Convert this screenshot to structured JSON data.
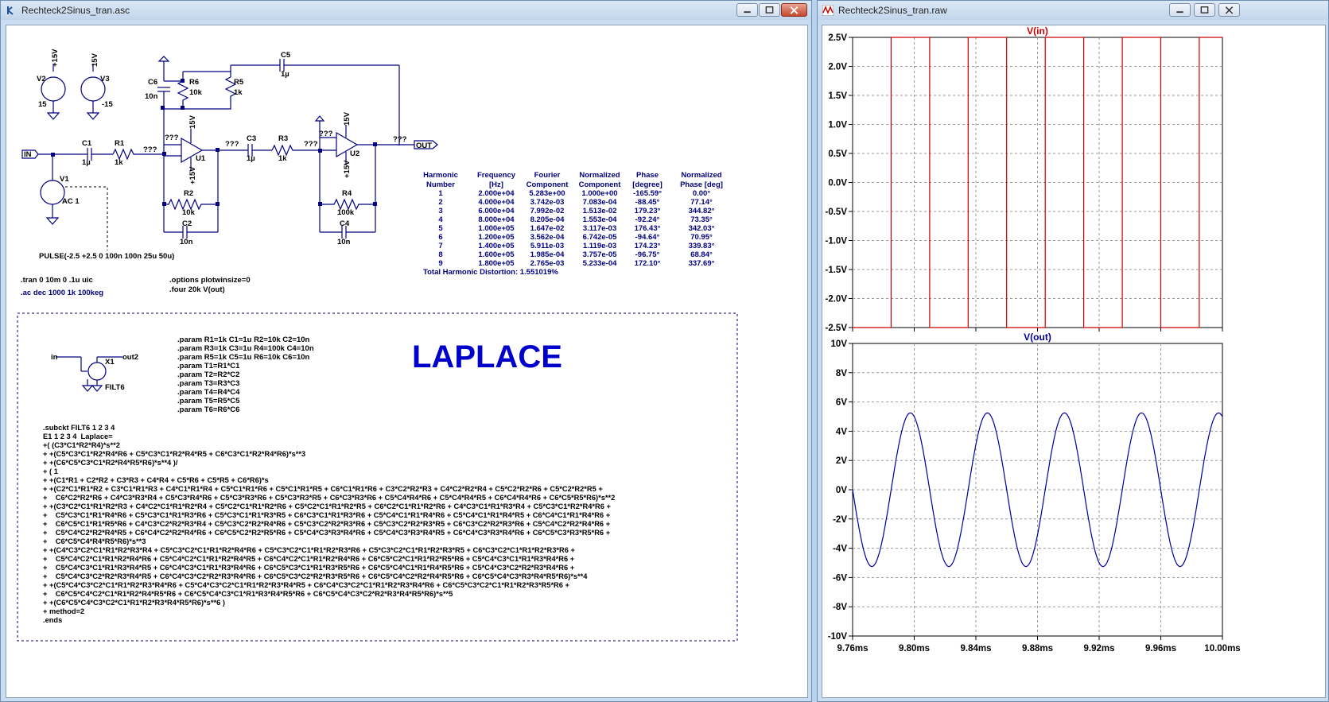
{
  "left_window": {
    "title": "Rechteck2Sinus_tran.asc",
    "schematic": {
      "v2": {
        "name": "V2",
        "rail": "+15V",
        "value": "15"
      },
      "v3": {
        "name": "V3",
        "rail": "15V",
        "value": "-15"
      },
      "v1": {
        "name": "V1",
        "value": "AC 1",
        "pulse": "PULSE(-2.5 +2.5 0 100n 100n 25u 50u)"
      },
      "in_label": "IN",
      "out_label": "OUT",
      "c1": {
        "name": "C1",
        "value": "1µ"
      },
      "r1": {
        "name": "R1",
        "value": "1k"
      },
      "c6": {
        "name": "C6",
        "value": "10n"
      },
      "r6": {
        "name": "R6",
        "value": "10k"
      },
      "r5": {
        "name": "R5",
        "value": "1k"
      },
      "c5": {
        "name": "C5",
        "value": "1µ"
      },
      "u1": {
        "name": "U1",
        "vplus": "15V",
        "vminus": "+15V"
      },
      "r2": {
        "name": "R2",
        "value": "10k"
      },
      "c2": {
        "name": "C2",
        "value": "10n"
      },
      "c3": {
        "name": "C3",
        "value": "1µ"
      },
      "r3": {
        "name": "R3",
        "value": "1k"
      },
      "u2": {
        "name": "U2",
        "vplus": "15V",
        "vminus": "+15V"
      },
      "r4": {
        "name": "R4",
        "value": "100k"
      },
      "c4": {
        "name": "C4",
        "value": "10n"
      },
      "unknown": "???",
      "x1": {
        "name": "X1",
        "model": "FILT6",
        "in": "in",
        "out": "out2"
      }
    },
    "directives": {
      "tran": ".tran 0 10m 0 .1u uic",
      "ac": ".ac dec 1000 1k 100keg",
      "options": ".options plotwinsize=0",
      "four": ".four 20k V(out)"
    },
    "fourier": {
      "header1": [
        "Harmonic",
        "Frequency",
        "Fourier",
        "Normalized",
        "Phase",
        "Normalized"
      ],
      "header2": [
        "Number",
        "[Hz]",
        "Component",
        "Component",
        "[degree]",
        "Phase [deg]"
      ],
      "rows": [
        [
          "1",
          "2.000e+04",
          "5.283e+00",
          "1.000e+00",
          "-165.59°",
          "0.00°"
        ],
        [
          "2",
          "4.000e+04",
          "3.742e-03",
          "7.083e-04",
          "-88.45°",
          "77.14°"
        ],
        [
          "3",
          "6.000e+04",
          "7.992e-02",
          "1.513e-02",
          "179.23°",
          "344.82°"
        ],
        [
          "4",
          "8.000e+04",
          "8.205e-04",
          "1.553e-04",
          "-92.24°",
          "73.35°"
        ],
        [
          "5",
          "1.000e+05",
          "1.647e-02",
          "3.117e-03",
          "176.43°",
          "342.03°"
        ],
        [
          "6",
          "1.200e+05",
          "3.562e-04",
          "6.742e-05",
          "-94.64°",
          "70.95°"
        ],
        [
          "7",
          "1.400e+05",
          "5.911e-03",
          "1.119e-03",
          "174.23°",
          "339.83°"
        ],
        [
          "8",
          "1.600e+05",
          "1.985e-04",
          "3.757e-05",
          "-96.75°",
          "68.84°"
        ],
        [
          "9",
          "1.800e+05",
          "2.765e-03",
          "5.233e-04",
          "172.10°",
          "337.69°"
        ]
      ],
      "thd": "Total Harmonic Distortion: 1.551019%"
    },
    "laplace_title": "LAPLACE",
    "params": [
      ".param R1=1k C1=1u R2=10k C2=10n",
      ".param R3=1k C3=1u R4=100k C4=10n",
      ".param R5=1k C5=1u R6=10k C6=10n",
      ".param T1=R1*C1",
      ".param T2=R2*C2",
      ".param T3=R3*C3",
      ".param T4=R4*C4",
      ".param T5=R5*C5",
      ".param T6=R6*C6"
    ],
    "subckt": [
      ".subckt FILT6 1 2 3 4",
      "E1 1 2 3 4  Laplace=",
      "+( (C3*C1*R2*R4)*s**2",
      "+ +(C5*C3*C1*R2*R4*R6 + C5*C3*C1*R2*R4*R5 + C6*C3*C1*R2*R4*R6)*s**3",
      "+ +(C6*C5*C3*C1*R2*R4*R5*R6)*s**4 )/",
      "+ ( 1",
      "+ +(C1*R1 + C2*R2 + C3*R3 + C4*R4 + C5*R6 + C5*R5 + C6*R6)*s",
      "+ +(C2*C1*R1*R2 + C3*C1*R1*R3 + C4*C1*R1*R4 + C5*C1*R1*R6 + C5*C1*R1*R5 + C6*C1*R1*R6 + C3*C2*R2*R3 + C4*C2*R2*R4 + C5*C2*R2*R6 + C5*C2*R2*R5 +",
      "+    C6*C2*R2*R6 + C4*C3*R3*R4 + C5*C3*R4*R6 + C5*C3*R3*R6 + C5*C3*R3*R5 + C6*C3*R3*R6 + C5*C4*R4*R6 + C5*C4*R4*R5 + C6*C4*R4*R6 + C6*C5*R5*R6)*s**2",
      "+ +(C3*C2*C1*R1*R2*R3 + C4*C2*C1*R1*R2*R4 + C5*C2*C1*R1*R2*R6 + C5*C2*C1*R1*R2*R5 + C6*C2*C1*R1*R2*R6 + C4*C3*C1*R1*R3*R4 + C5*C3*C1*R2*R4*R6 +",
      "+    C5*C3*C1*R1*R4*R6 + C5*C3*C1*R1*R3*R6 + C5*C3*C1*R1*R3*R5 + C6*C3*C1*R1*R3*R6 + C5*C4*C1*R1*R4*R6 + C5*C4*C1*R1*R4*R5 + C6*C4*C1*R1*R4*R6 +",
      "+    C6*C5*C1*R1*R5*R6 + C4*C3*C2*R2*R3*R4 + C5*C3*C2*R2*R4*R6 + C5*C3*C2*R2*R3*R6 + C5*C3*C2*R2*R3*R5 + C6*C3*C2*R2*R3*R6 + C5*C4*C2*R2*R4*R6 +",
      "+    C5*C4*C2*R2*R4*R5 + C6*C4*C2*R2*R4*R6 + C6*C5*C2*R2*R5*R6 + C5*C4*C3*R3*R4*R6 + C5*C4*C3*R3*R4*R5 + C6*C4*C3*R3*R4*R6 + C6*C5*C3*R3*R5*R6 +",
      "+    C6*C5*C4*R4*R5*R6)*s**3",
      "+ +(C4*C3*C2*C1*R1*R2*R3*R4 + C5*C3*C2*C1*R1*R2*R4*R6 + C5*C3*C2*C1*R1*R2*R3*R6 + C5*C3*C2*C1*R1*R2*R3*R5 + C6*C3*C2*C1*R1*R2*R3*R6 +",
      "+    C5*C4*C2*C1*R1*R2*R4*R6 + C5*C4*C2*C1*R1*R2*R4*R5 + C6*C4*C2*C1*R1*R2*R4*R6 + C6*C5*C2*C1*R1*R2*R5*R6 + C5*C4*C3*C1*R1*R3*R4*R6 +",
      "+    C5*C4*C3*C1*R1*R3*R4*R5 + C6*C4*C3*C1*R1*R3*R4*R6 + C6*C5*C3*C1*R1*R3*R5*R6 + C6*C5*C4*C1*R1*R4*R5*R6 + C5*C4*C3*C2*R2*R3*R4*R6 +",
      "+    C5*C4*C3*C2*R2*R3*R4*R5 + C6*C4*C3*C2*R2*R3*R4*R6 + C6*C5*C3*C2*R2*R3*R5*R6 + C6*C5*C4*C2*R2*R4*R5*R6 + C6*C5*C4*C3*R3*R4*R5*R6)*s**4",
      "+ +(C5*C4*C3*C2*C1*R1*R2*R3*R4*R6 + C5*C4*C3*C2*C1*R1*R2*R3*R4*R5 + C6*C4*C3*C2*C1*R1*R2*R3*R4*R6 + C6*C5*C3*C2*C1*R1*R2*R3*R5*R6 +",
      "+    C6*C5*C4*C2*C1*R1*R2*R4*R5*R6 + C6*C5*C4*C3*C1*R1*R3*R4*R5*R6 + C6*C5*C4*C3*C2*R2*R3*R4*R5*R6)*s**5",
      "+ +(C6*C5*C4*C3*C2*C1*R1*R2*R3*R4*R5*R6)*s**6 )",
      "+ method=2",
      ".ends"
    ]
  },
  "right_window": {
    "title": "Rechteck2Sinus_tran.raw",
    "colors": {
      "vin": "#cc0000",
      "vout": "#000099",
      "grid": "#999999"
    },
    "chart_data": [
      {
        "type": "line",
        "title": "V(in)",
        "x_range": [
          9.76,
          10.0
        ],
        "ylim": [
          -2.5,
          2.5
        ],
        "y_ticks": [
          "2.5V",
          "2.0V",
          "1.5V",
          "1.0V",
          "0.5V",
          "0.0V",
          "-0.5V",
          "-1.0V",
          "-1.5V",
          "-2.0V",
          "-2.5V"
        ],
        "x": [
          9.76,
          9.785,
          9.785,
          9.81,
          9.81,
          9.835,
          9.835,
          9.86,
          9.86,
          9.885,
          9.885,
          9.91,
          9.91,
          9.935,
          9.935,
          9.96,
          9.96,
          9.985,
          9.985,
          10.0
        ],
        "values": [
          -2.5,
          -2.5,
          2.5,
          2.5,
          -2.5,
          -2.5,
          2.5,
          2.5,
          -2.5,
          -2.5,
          2.5,
          2.5,
          -2.5,
          -2.5,
          2.5,
          2.5,
          -2.5,
          -2.5,
          2.5,
          2.5
        ],
        "grid": true
      },
      {
        "type": "line",
        "title": "V(out)",
        "x_range": [
          9.76,
          10.0
        ],
        "ylim": [
          -10,
          10
        ],
        "y_ticks": [
          "10V",
          "8V",
          "6V",
          "4V",
          "2V",
          "0V",
          "-2V",
          "-4V",
          "-6V",
          "-8V",
          "-10V"
        ],
        "x_ticks": [
          "9.76ms",
          "9.80ms",
          "9.84ms",
          "9.88ms",
          "9.92ms",
          "9.96ms",
          "10.00ms"
        ],
        "amplitude": 5.25,
        "period_ms": 0.05,
        "peak_at_ms": 9.7975,
        "grid": true
      }
    ]
  }
}
